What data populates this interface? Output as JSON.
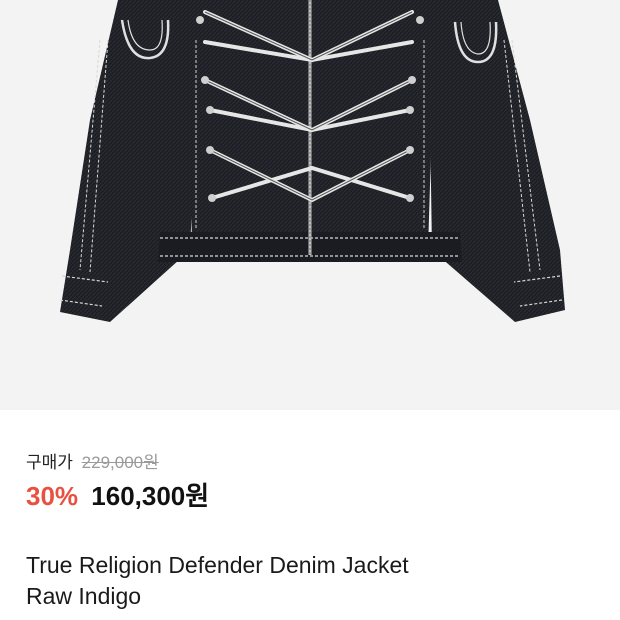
{
  "product": {
    "image_alt_icon": "denim-jacket-image",
    "price_label": "구매가",
    "original_price": "229,000원",
    "discount_percent": "30%",
    "sale_price": "160,300원",
    "title_line1": "True Religion Defender Denim Jacket",
    "title_line2": "Raw Indigo"
  },
  "colors": {
    "discount": "#e8513f",
    "background_image": "#f3f3f3",
    "denim": "#1c1e22",
    "stitching": "#e8e8e8"
  }
}
